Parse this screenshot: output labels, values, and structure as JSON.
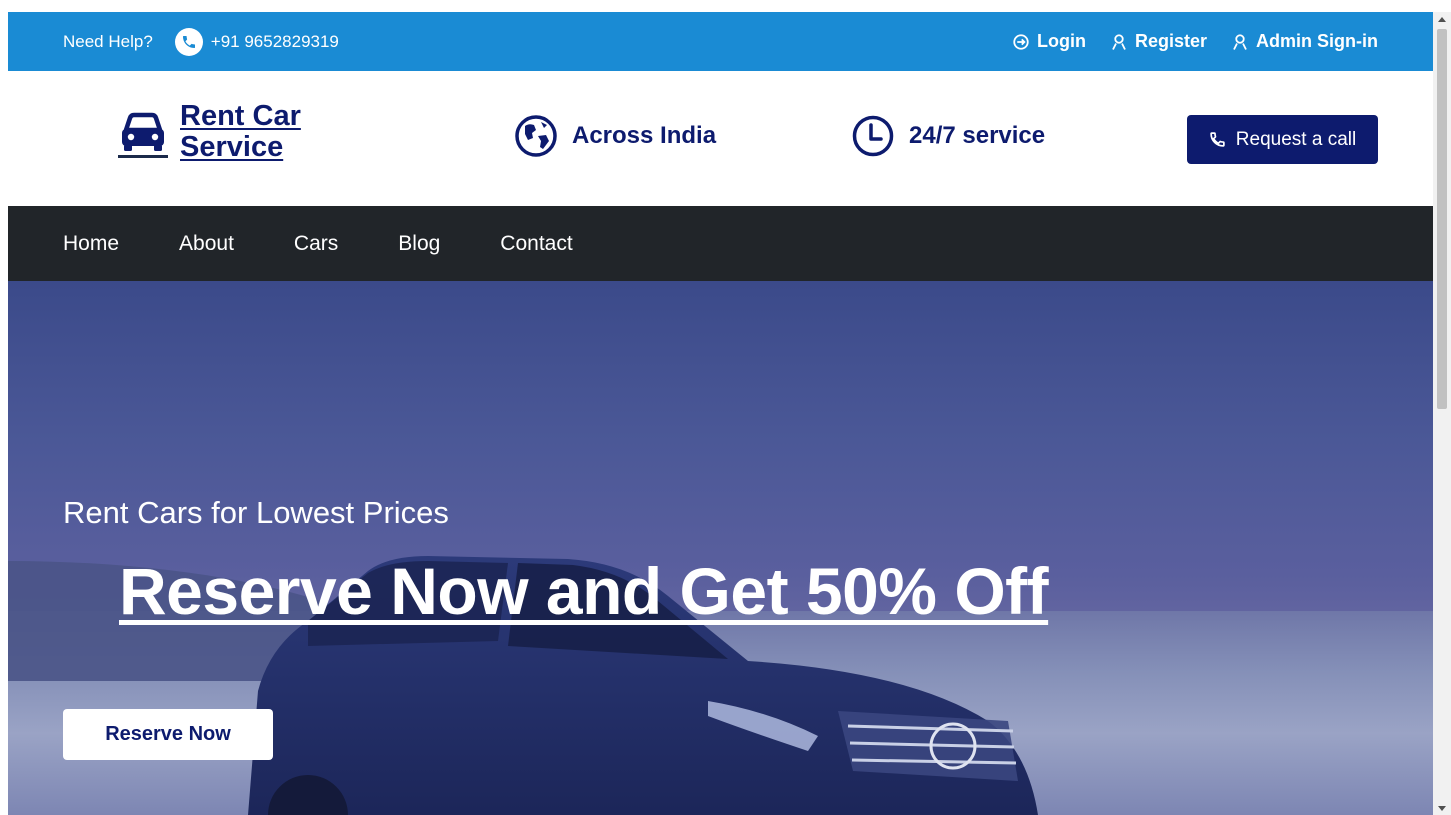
{
  "topbar": {
    "help_label": "Need Help?",
    "phone": "+91 9652829319",
    "links": [
      {
        "label": "Login",
        "icon": "login-icon"
      },
      {
        "label": "Register",
        "icon": "user-icon"
      },
      {
        "label": "Admin Sign-in",
        "icon": "user-icon"
      }
    ],
    "bg_color": "#1a8bd4"
  },
  "brand": {
    "name_line1": "Rent Car",
    "name_line2": "Service",
    "icon": "car-icon",
    "color": "#0d1b6e"
  },
  "features": [
    {
      "label": "Across India",
      "icon": "globe-icon"
    },
    {
      "label": "24/7 service",
      "icon": "clock-icon"
    }
  ],
  "request_call": {
    "label": "Request a call",
    "icon": "phone-icon"
  },
  "nav": {
    "items": [
      "Home",
      "About",
      "Cars",
      "Blog",
      "Contact"
    ],
    "bg_color": "#212529"
  },
  "hero": {
    "subtitle": "Rent Cars for Lowest Prices",
    "headline": "Reserve Now and Get 50% Off",
    "cta": "Reserve Now"
  }
}
